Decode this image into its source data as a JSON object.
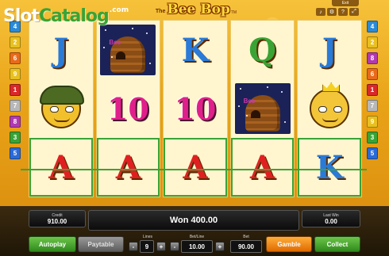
{
  "watermark": {
    "part1": "Slot",
    "part2": "Catalog",
    "suffix": ".com"
  },
  "title": {
    "prefix": "The",
    "name": "Bee Bop",
    "tm": "TM"
  },
  "top_controls": {
    "exit_label": "Exit",
    "icons": [
      "sound-icon",
      "settings-icon",
      "help-icon",
      "fullscreen-icon"
    ]
  },
  "line_markers": {
    "left": [
      {
        "label": "4",
        "color": "#2a8ad8"
      },
      {
        "label": "2",
        "color": "#e8c020"
      },
      {
        "label": "6",
        "color": "#e86a1a"
      },
      {
        "label": "9",
        "color": "#e8c020"
      },
      {
        "label": "1",
        "color": "#d8282a"
      },
      {
        "label": "7",
        "color": "#b8b8b8"
      },
      {
        "label": "8",
        "color": "#b03ab0"
      },
      {
        "label": "3",
        "color": "#3aa335"
      },
      {
        "label": "5",
        "color": "#2a6ad8"
      }
    ],
    "right": [
      {
        "label": "4",
        "color": "#2a8ad8"
      },
      {
        "label": "2",
        "color": "#e8c020"
      },
      {
        "label": "8",
        "color": "#b03ab0"
      },
      {
        "label": "6",
        "color": "#e86a1a"
      },
      {
        "label": "1",
        "color": "#d8282a"
      },
      {
        "label": "7",
        "color": "#b8b8b8"
      },
      {
        "label": "9",
        "color": "#e8c020"
      },
      {
        "label": "3",
        "color": "#3aa335"
      },
      {
        "label": "5",
        "color": "#2a6ad8"
      }
    ]
  },
  "reels": [
    [
      {
        "type": "letter",
        "text": "J",
        "color": "#2a7ad8"
      },
      {
        "type": "soldier-bee"
      },
      {
        "type": "letter",
        "text": "A",
        "color": "#e02020",
        "win": true
      }
    ],
    [
      {
        "type": "hive"
      },
      {
        "type": "ten",
        "text": "10"
      },
      {
        "type": "letter",
        "text": "A",
        "color": "#e02020",
        "win": true
      }
    ],
    [
      {
        "type": "letter",
        "text": "K",
        "color": "#2a7ad8"
      },
      {
        "type": "ten",
        "text": "10"
      },
      {
        "type": "letter",
        "text": "A",
        "color": "#e02020",
        "win": true
      }
    ],
    [
      {
        "type": "letter",
        "text": "Q",
        "color": "#3aa335"
      },
      {
        "type": "hive"
      },
      {
        "type": "letter",
        "text": "A",
        "color": "#e02020",
        "win": true
      }
    ],
    [
      {
        "type": "letter",
        "text": "J",
        "color": "#2a7ad8"
      },
      {
        "type": "queen-bee"
      },
      {
        "type": "letter",
        "text": "K",
        "color": "#2a7ad8",
        "win": true
      }
    ]
  ],
  "hive_tag": "Bee",
  "panel": {
    "credit_label": "Credit",
    "credit_value": "910.00",
    "message": "Won 400.00",
    "last_win_label": "Last Win",
    "last_win_value": "0.00",
    "autoplay": "Autoplay",
    "paytable": "Paytable",
    "lines_label": "Lines",
    "lines_value": "9",
    "betline_label": "Bet/Line",
    "betline_value": "10.00",
    "bet_label": "Bet",
    "bet_value": "90.00",
    "gamble": "Gamble",
    "collect": "Collect",
    "minus": "-",
    "plus": "+"
  }
}
